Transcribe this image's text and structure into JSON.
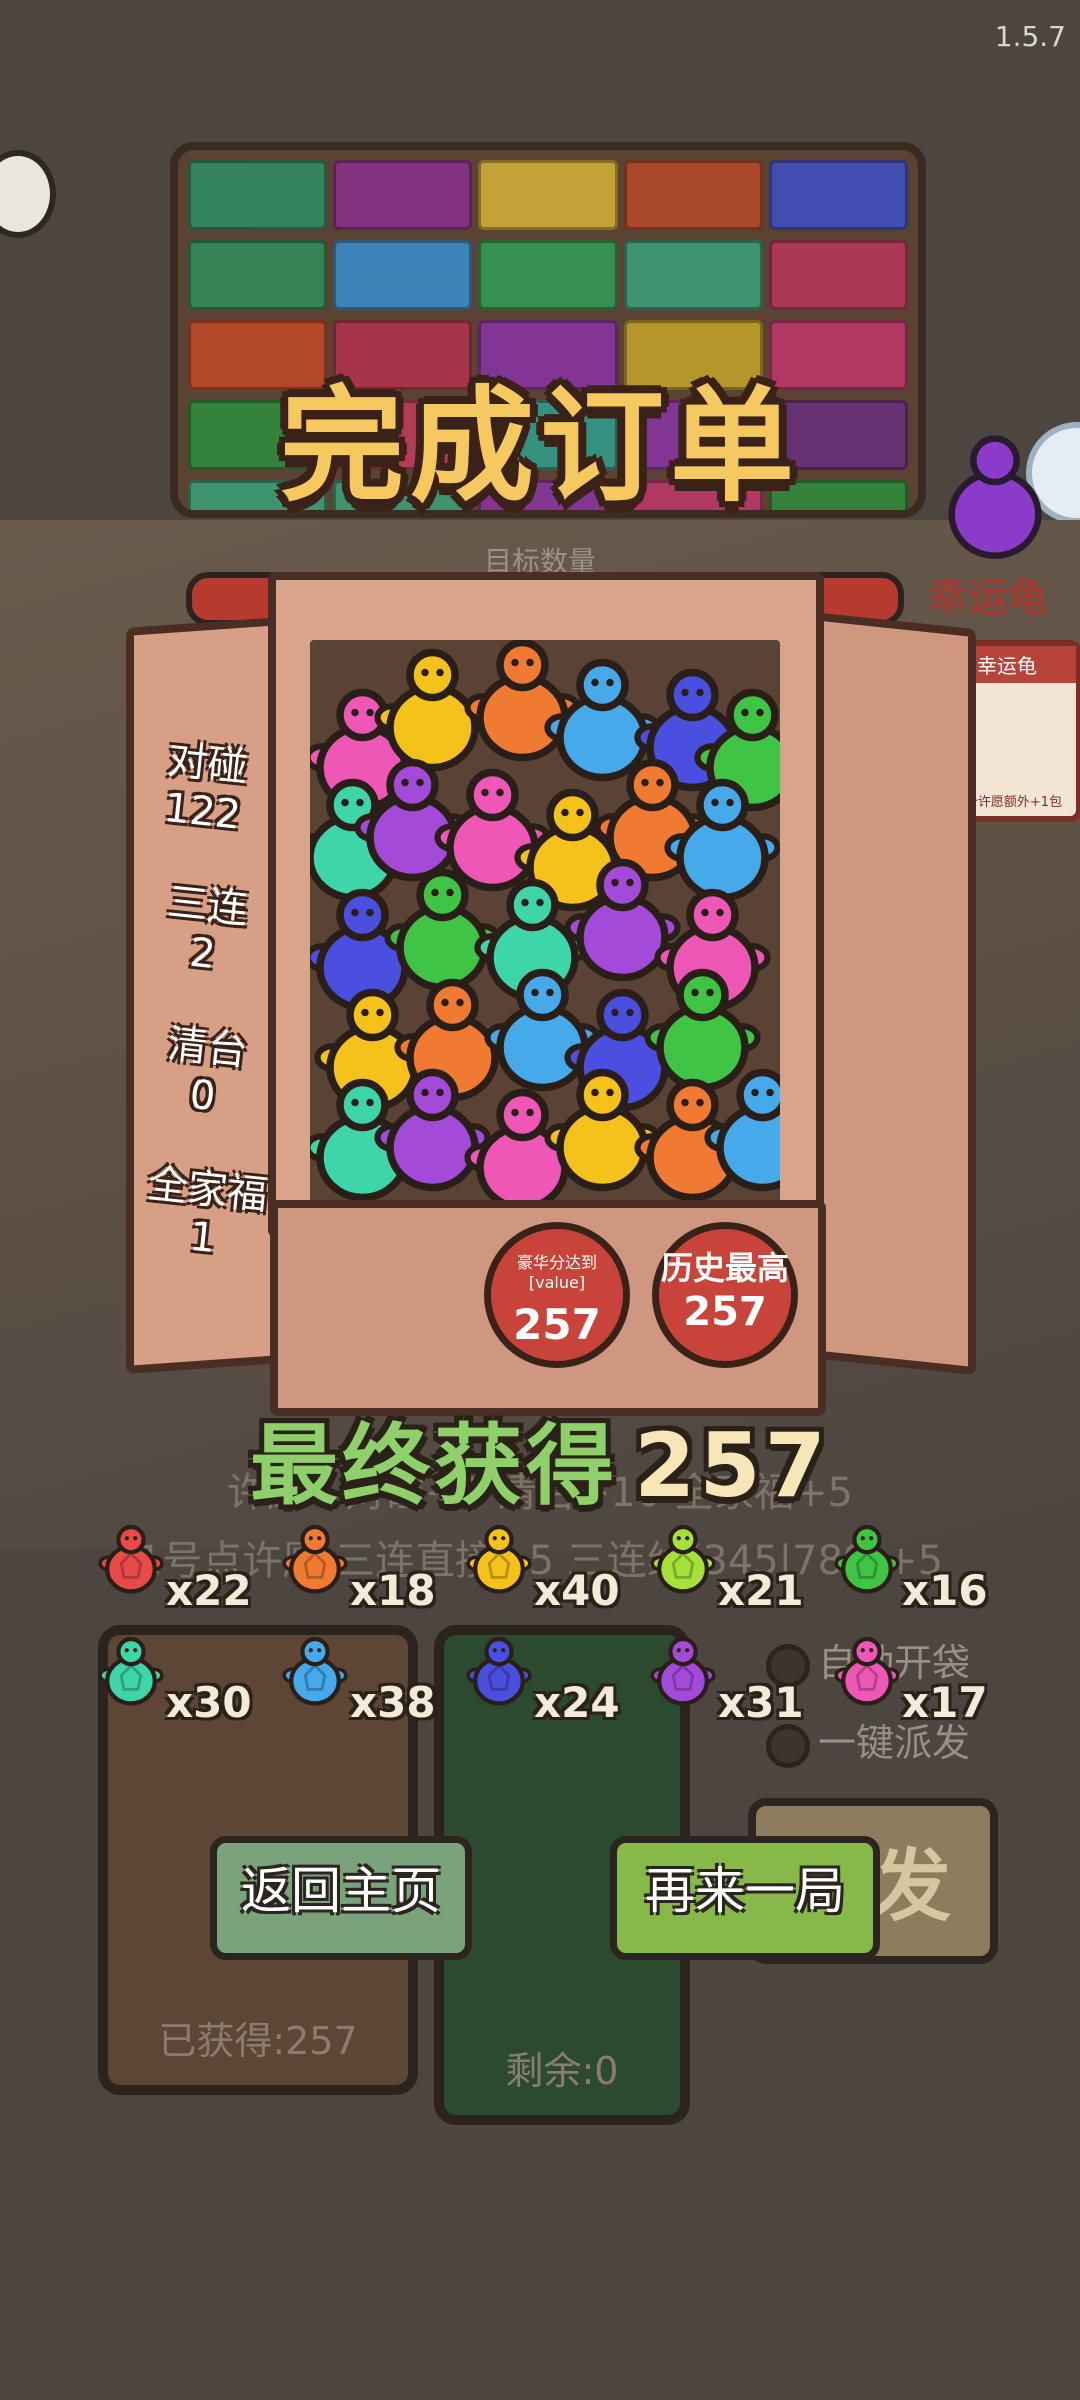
{
  "version": "1.5.7",
  "title": "完成订单",
  "target_label": "目标数量",
  "lucky": {
    "label": "幸运龟",
    "card_header": "幸运龟",
    "card_footer": "每个许愿额外+1包"
  },
  "stats": [
    {
      "label": "对碰",
      "value": "122"
    },
    {
      "label": "三连",
      "value": "2"
    },
    {
      "label": "清台",
      "value": "0"
    },
    {
      "label": "全家福",
      "value": "1"
    }
  ],
  "badges": {
    "luxury": {
      "label": "豪华分达到[value]",
      "value": "257"
    },
    "best": {
      "label": "历史最高",
      "value": "257"
    }
  },
  "final": {
    "label": "最终获得",
    "value": "257"
  },
  "background_hints": {
    "line1": "许愿 · 对碰+1 清台+10 全家福+5",
    "line2": "1号点许愿 三连直接+5 三连线(345|789)+5"
  },
  "turtle_counts": [
    {
      "color": "#e84a4a",
      "count": "x22"
    },
    {
      "color": "#f07a32",
      "count": "x18"
    },
    {
      "color": "#f5c21c",
      "count": "x40"
    },
    {
      "color": "#a6e03a",
      "count": "x21"
    },
    {
      "color": "#3fc446",
      "count": "x16"
    },
    {
      "color": "#3ed6a8",
      "count": "x30"
    },
    {
      "color": "#45a9ea",
      "count": "x38"
    },
    {
      "color": "#4b4fe0",
      "count": "x24"
    },
    {
      "color": "#a44ad8",
      "count": "x31"
    },
    {
      "color": "#ef57b6",
      "count": "x17"
    }
  ],
  "checks": {
    "auto_open": "自动开袋",
    "one_click": "一键派发"
  },
  "deal_label": "派发",
  "bags": {
    "obtained": "已获得:257",
    "remaining": "剩余:0"
  },
  "buttons": {
    "home": "返回主页",
    "again": "再来一局"
  },
  "box_colors": [
    "#ef57b6",
    "#f5c21c",
    "#f07a32",
    "#45a9ea",
    "#4b4fe0",
    "#3fc446",
    "#3ed6a8",
    "#a44ad8"
  ]
}
